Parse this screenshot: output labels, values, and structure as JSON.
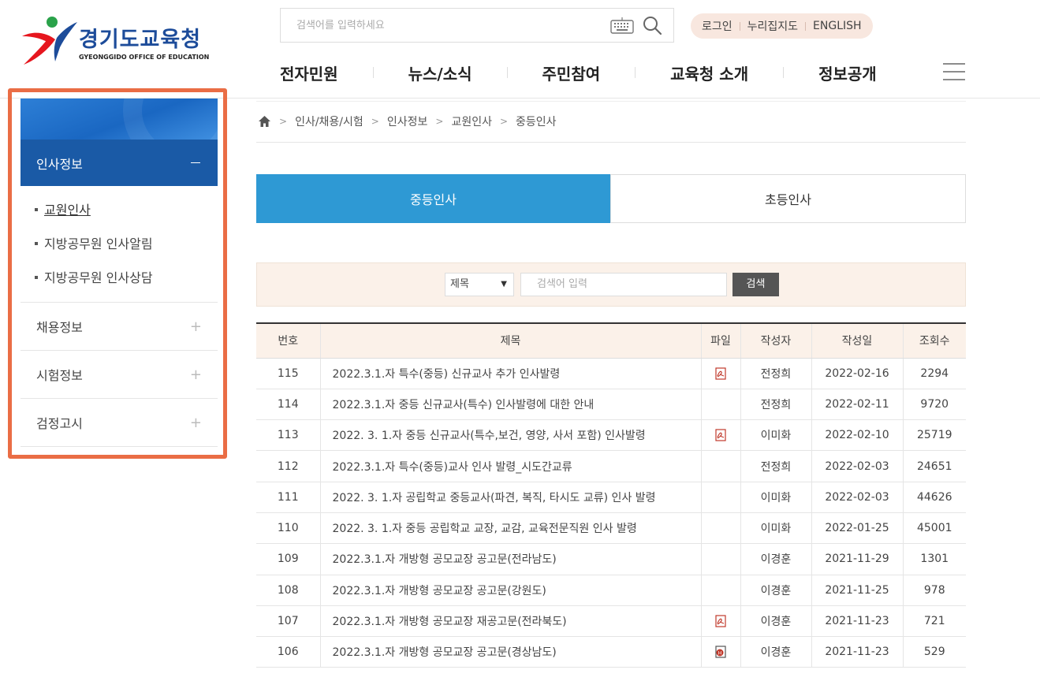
{
  "logo": {
    "title": "경기도교육청",
    "subtitle": "GYEONGGIDO OFFICE OF EDUCATION"
  },
  "search": {
    "placeholder": "검색어를 입력하세요",
    "keyboard_icon": "keyboard-icon",
    "search_icon": "magnifier-icon"
  },
  "util_links": [
    "로그인",
    "누리집지도",
    "ENGLISH"
  ],
  "gnb": [
    "전자민원",
    "뉴스/소식",
    "주민참여",
    "교육청 소개",
    "정보공개"
  ],
  "sidebar": {
    "heading": "인사정보",
    "sub_items": [
      "교원인사",
      "지방공무원 인사알림",
      "지방공무원 인사상담"
    ],
    "menus": [
      "채용정보",
      "시험정보",
      "검정고시"
    ]
  },
  "breadcrumb": [
    "인사/채용/시험",
    "인사정보",
    "교원인사",
    "중등인사"
  ],
  "tabs": [
    "중등인사",
    "초등인사"
  ],
  "search_panel": {
    "select_value": "제목",
    "input_placeholder": "검색어 입력",
    "button": "검색"
  },
  "table": {
    "headers": [
      "번호",
      "제목",
      "파일",
      "작성자",
      "작성일",
      "조회수"
    ],
    "rows": [
      {
        "no": "115",
        "title": "2022.3.1.자 특수(중등) 신규교사 추가 인사발령",
        "file": "pdf",
        "author": "전정희",
        "date": "2022-02-16",
        "views": "2294"
      },
      {
        "no": "114",
        "title": "2022.3.1.자 중등 신규교사(특수) 인사발령에 대한 안내",
        "file": "",
        "author": "전정희",
        "date": "2022-02-11",
        "views": "9720"
      },
      {
        "no": "113",
        "title": "2022. 3. 1.자 중등 신규교사(특수,보건, 영양, 사서 포함) 인사발령",
        "file": "pdf",
        "author": "이미화",
        "date": "2022-02-10",
        "views": "25719"
      },
      {
        "no": "112",
        "title": "2022.3.1.자 특수(중등)교사 인사 발령_시도간교류",
        "file": "",
        "author": "전정희",
        "date": "2022-02-03",
        "views": "24651"
      },
      {
        "no": "111",
        "title": "2022. 3. 1.자 공립학교 중등교사(파견, 복직, 타시도 교류) 인사 발령",
        "file": "",
        "author": "이미화",
        "date": "2022-02-03",
        "views": "44626"
      },
      {
        "no": "110",
        "title": "2022. 3. 1.자 중등 공립학교 교장, 교감, 교육전문직원 인사 발령",
        "file": "",
        "author": "이미화",
        "date": "2022-01-25",
        "views": "45001"
      },
      {
        "no": "109",
        "title": "2022.3.1.자 개방형 공모교장 공고문(전라남도)",
        "file": "",
        "author": "이경훈",
        "date": "2021-11-29",
        "views": "1301"
      },
      {
        "no": "108",
        "title": "2022.3.1.자 개방형 공모교장 공고문(강원도)",
        "file": "",
        "author": "이경훈",
        "date": "2021-11-25",
        "views": "978"
      },
      {
        "no": "107",
        "title": "2022.3.1.자 개방형 공모교장 재공고문(전라북도)",
        "file": "pdf",
        "author": "이경훈",
        "date": "2021-11-23",
        "views": "721"
      },
      {
        "no": "106",
        "title": "2022.3.1.자 개방형 공모교장 공고문(경상남도)",
        "file": "hwp",
        "author": "이경훈",
        "date": "2021-11-23",
        "views": "529"
      }
    ]
  },
  "colors": {
    "brand_blue": "#1a5aa6",
    "tab_active": "#2e99d4",
    "highlight": "#ea6d45",
    "panel_bg": "#fbf1e9"
  }
}
